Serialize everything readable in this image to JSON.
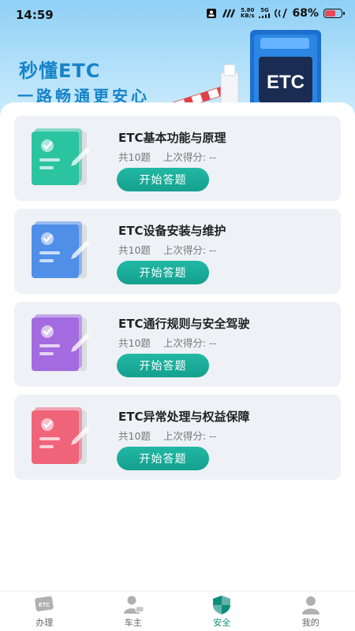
{
  "status_bar": {
    "time": "14:59",
    "net_speed_value": "5.80",
    "net_speed_unit": "KB/s",
    "signal_label": "5G",
    "battery_percent": "68%",
    "battery_level": 0.68
  },
  "hero": {
    "title": "秒懂ETC",
    "slogan": "一路畅通更安心",
    "sign_text": "ETC"
  },
  "cards": [
    {
      "title": "ETC基本功能与原理",
      "count": "共10题",
      "score": "上次得分: --",
      "button": "开始答题",
      "color": "#2bc4a0"
    },
    {
      "title": "ETC设备安装与维护",
      "count": "共10题",
      "score": "上次得分: --",
      "button": "开始答题",
      "color": "#4f8fe8"
    },
    {
      "title": "ETC通行规则与安全驾驶",
      "count": "共10题",
      "score": "上次得分: --",
      "button": "开始答题",
      "color": "#a46be0"
    },
    {
      "title": "ETC异常处理与权益保障",
      "count": "共10题",
      "score": "上次得分: --",
      "button": "开始答题",
      "color": "#f0647a"
    }
  ],
  "tabbar": {
    "items": [
      {
        "label": "办理",
        "icon_text": "ETC",
        "active": false
      },
      {
        "label": "车主",
        "active": false
      },
      {
        "label": "安全",
        "active": true
      },
      {
        "label": "我的",
        "active": false
      }
    ],
    "active_color": "#0f8d7c",
    "inactive_color": "#b0b0b0"
  }
}
